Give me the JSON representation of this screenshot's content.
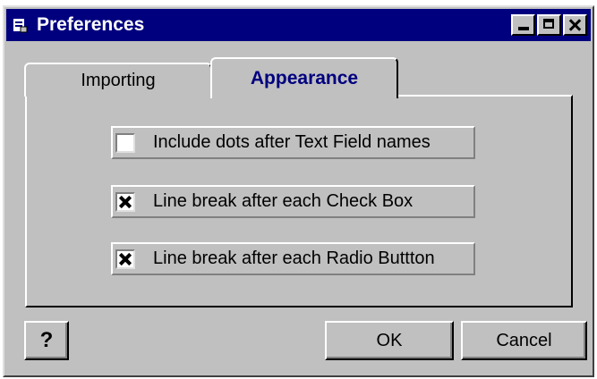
{
  "window": {
    "title": "Preferences",
    "controls": [
      "minimize",
      "maximize",
      "close"
    ]
  },
  "tabs": [
    {
      "label": "Importing",
      "active": false
    },
    {
      "label": "Appearance",
      "active": true
    }
  ],
  "options": [
    {
      "label": "Include dots after Text Field names",
      "checked": false
    },
    {
      "label": "Line break after each Check Box",
      "checked": true
    },
    {
      "label": "Line break after each Radio Buttton",
      "checked": true
    }
  ],
  "buttons": {
    "help_label": "?",
    "ok_label": "OK",
    "cancel_label": "Cancel"
  },
  "colors": {
    "titlebar": "#00007f",
    "face": "#c0c0c0",
    "active_tab_text": "#00007f"
  },
  "icons": {
    "title": "window-app-icon",
    "help": "help-question-icon"
  }
}
